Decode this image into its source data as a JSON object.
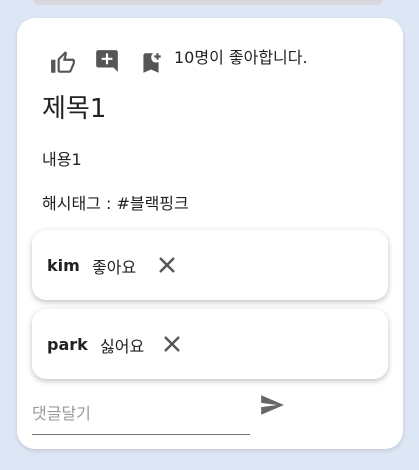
{
  "post": {
    "like_count_text": "10명이 좋아합니다.",
    "title": "제목1",
    "content": "내용1",
    "hashtag": "해시태그 : #블랙핑크"
  },
  "icons": {
    "like": "thumb-up-icon",
    "comment": "add-comment-icon",
    "bookmark": "bookmark-add-icon",
    "delete": "close-icon",
    "send": "send-icon"
  },
  "comments": [
    {
      "author": "kim",
      "text": "좋아요"
    },
    {
      "author": "park",
      "text": "싫어요"
    }
  ],
  "comment_form": {
    "placeholder": "댓글달기",
    "value": ""
  },
  "colors": {
    "background": "#dde6f4",
    "card": "#ffffff",
    "icon": "#555555"
  }
}
